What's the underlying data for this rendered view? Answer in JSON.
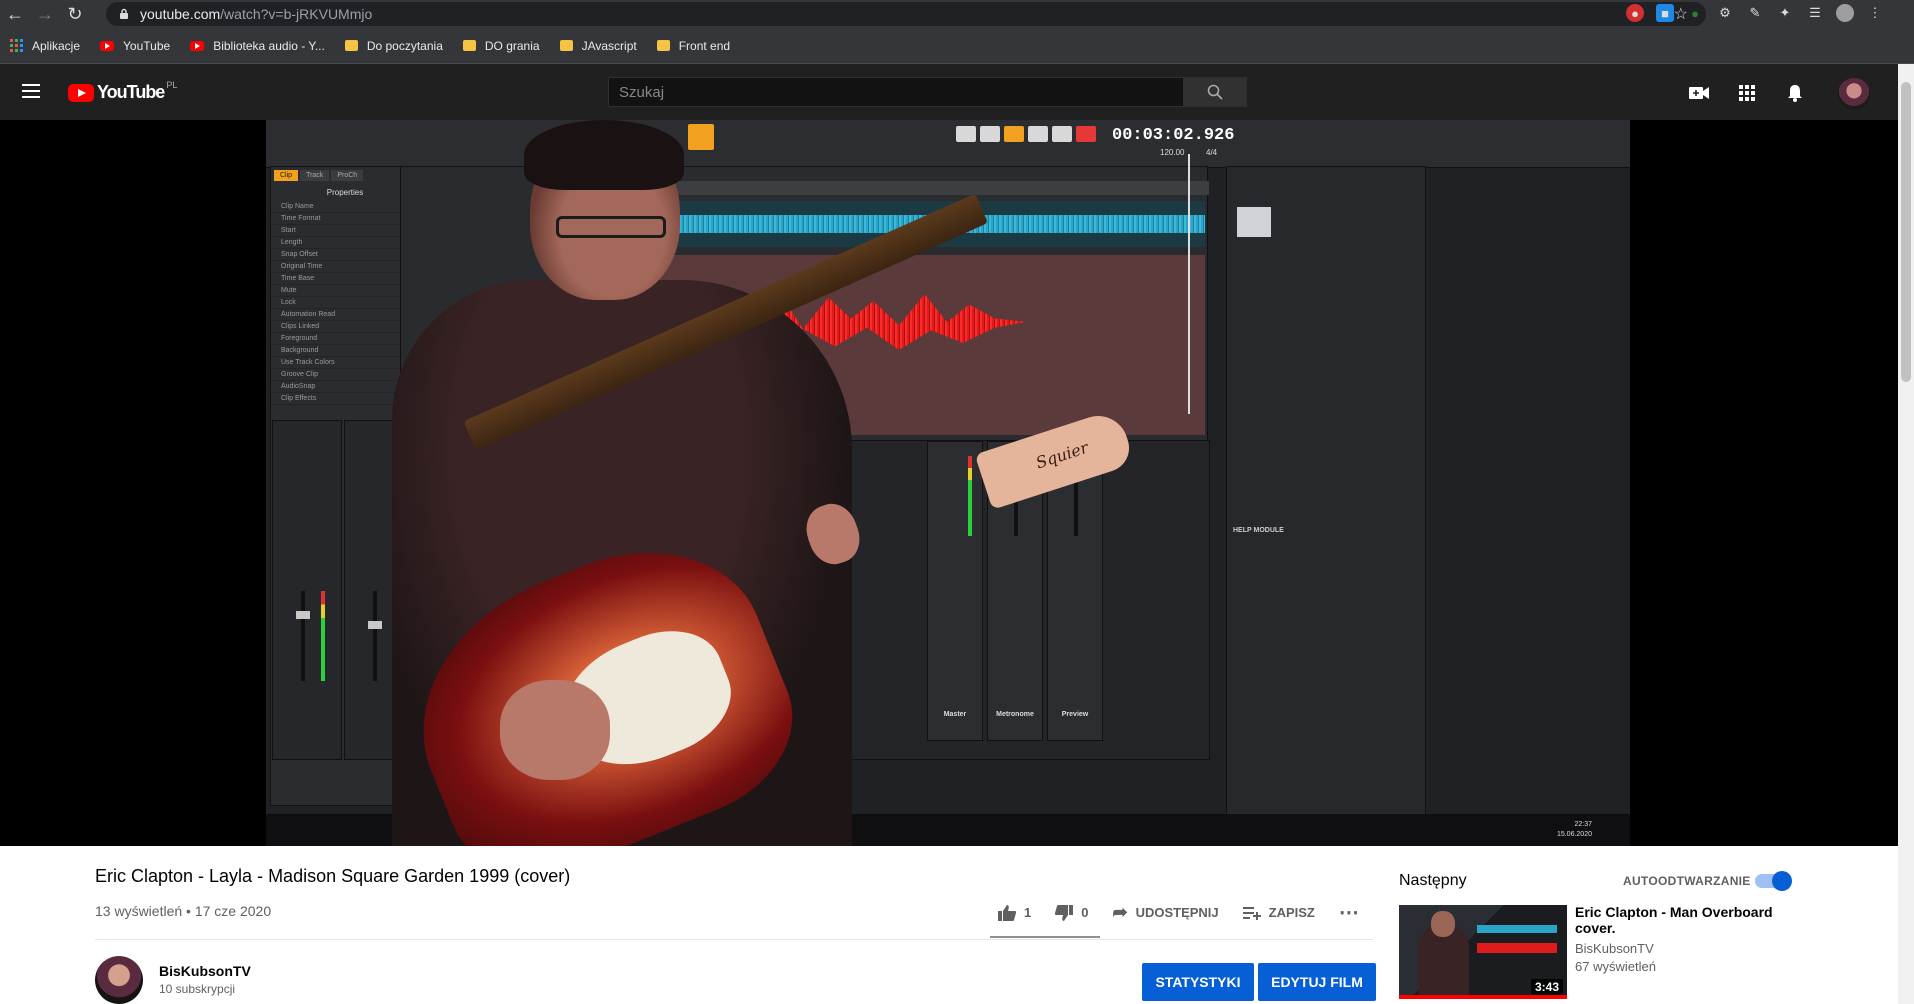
{
  "browser": {
    "url_host": "youtube.com",
    "url_path": "/watch?v=b-jRKVUMmjo",
    "bookmarks": [
      {
        "label": "Aplikacje",
        "icon": "apps-icon"
      },
      {
        "label": "YouTube",
        "icon": "youtube-icon"
      },
      {
        "label": "Biblioteka audio - Y...",
        "icon": "youtube-icon"
      },
      {
        "label": "Do poczytania",
        "icon": "folder-icon"
      },
      {
        "label": "DO grania",
        "icon": "folder-icon"
      },
      {
        "label": "JAvascript",
        "icon": "folder-icon"
      },
      {
        "label": "Front end",
        "icon": "folder-icon"
      }
    ]
  },
  "masthead": {
    "logo_text": "YouTube",
    "logo_country": "PL",
    "search_placeholder": "Szukaj"
  },
  "player": {
    "daw_time": "00:03:02.926",
    "daw_tempo": "120.00",
    "daw_meter": "4/4",
    "properties_title": "Properties",
    "tabs": [
      "Clip",
      "Track",
      "ProCh"
    ],
    "properties": [
      "Clip Name",
      "Time Format",
      "Start",
      "Length",
      "Snap Offset",
      "Original Time",
      "Time Base",
      "Mute",
      "Lock",
      "Automation Read",
      "Clips Linked",
      "Foreground",
      "Background",
      "Use Track Colors",
      "Groove Clip",
      "AudioSnap",
      "Clip Effects"
    ],
    "buses": [
      "Master",
      "Metronome",
      "Preview"
    ],
    "help_module": "HELP MODULE",
    "headstock_brand": "Squier",
    "clock_time": "22:37",
    "clock_date": "15.06.2020"
  },
  "video": {
    "title": "Eric Clapton - Layla - Madison Square Garden 1999 (cover)",
    "meta": "13 wyświetleń • 17 cze 2020",
    "likes": "1",
    "dislikes": "0",
    "share_label": "UDOSTĘPNIJ",
    "save_label": "ZAPISZ"
  },
  "channel": {
    "name": "BisKubsonTV",
    "subs": "10 subskrypcji",
    "stats_button": "STATYSTYKI",
    "edit_button": "EDYTUJ FILM"
  },
  "sidebar": {
    "next_label": "Następny",
    "autoplay_label": "AUTOODTWARZANIE",
    "autoplay_on": true,
    "next_video": {
      "title": "Eric Clapton - Man Overboard cover.",
      "channel": "BisKubsonTV",
      "views": "67 wyświetleń",
      "duration": "3:43"
    }
  },
  "colors": {
    "yt_red": "#ff0000",
    "button_blue": "#065fd4",
    "masthead_bg": "#202020"
  }
}
